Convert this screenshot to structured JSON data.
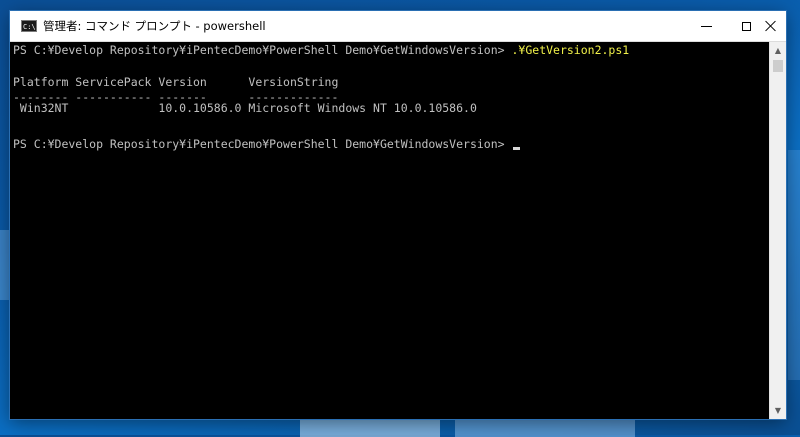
{
  "window": {
    "title": "管理者: コマンド プロンプト - powershell",
    "icon_label": "C:\\"
  },
  "console": {
    "prompt1": "PS C:¥Develop Repository¥iPentecDemo¥PowerShell Demo¥GetWindowsVersion> ",
    "command1": ".¥GetVersion2.ps1",
    "header": "Platform ServicePack Version      VersionString",
    "separator": "-------- ----------- -------      -------------",
    "row": " Win32NT             10.0.10586.0 Microsoft Windows NT 10.0.10586.0",
    "prompt2": "PS C:¥Develop Repository¥iPentecDemo¥PowerShell Demo¥GetWindowsVersion> "
  },
  "colors": {
    "console_bg": "#000000",
    "console_text": "#c0c0c0",
    "command_text": "#f1f14a",
    "desktop_bg": "#0a5aa8"
  },
  "icons": {
    "app": "cmd-icon",
    "minimize": "minimize-icon",
    "maximize": "maximize-icon",
    "close": "close-icon",
    "scroll_up": "scroll-up-arrow-icon",
    "scroll_down": "scroll-down-arrow-icon"
  }
}
